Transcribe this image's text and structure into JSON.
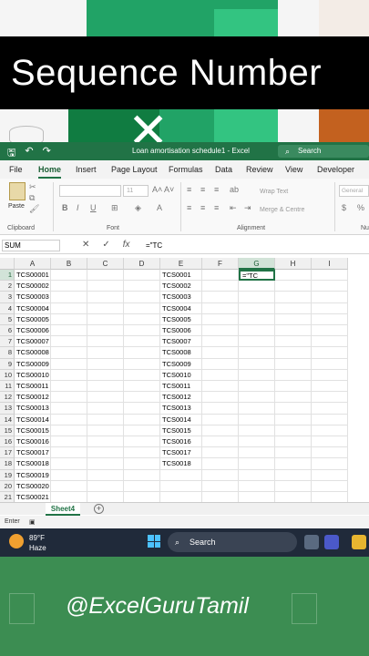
{
  "banner": {
    "title": "Sequence Number"
  },
  "excel": {
    "doc_title": "Loan amortisation schedule1 - Excel",
    "search_placeholder": "Search",
    "menu": [
      "File",
      "Home",
      "Insert",
      "Page Layout",
      "Formulas",
      "Data",
      "Review",
      "View",
      "Developer"
    ],
    "ribbon": {
      "paste": "Paste",
      "clipboard": "Clipboard",
      "font": "Font",
      "font_size": "11",
      "alignment": "Alignment",
      "wrap_text": "Wrap Text",
      "merge_centre": "Merge & Centre",
      "number_format": "General",
      "number_label": "Nu"
    },
    "name_box": "SUM",
    "formula_value": "=\"TC",
    "columns": [
      "A",
      "B",
      "C",
      "D",
      "E",
      "F",
      "G",
      "H",
      "I"
    ],
    "selected_column": "G",
    "rows": [
      {
        "n": "1",
        "A": "TCS00001",
        "E": "TCS0001",
        "G": "=\"TC"
      },
      {
        "n": "2",
        "A": "TCS00002",
        "E": "TCS0002"
      },
      {
        "n": "3",
        "A": "TCS00003",
        "E": "TCS0003"
      },
      {
        "n": "4",
        "A": "TCS00004",
        "E": "TCS0004"
      },
      {
        "n": "5",
        "A": "TCS00005",
        "E": "TCS0005"
      },
      {
        "n": "6",
        "A": "TCS00006",
        "E": "TCS0006"
      },
      {
        "n": "7",
        "A": "TCS00007",
        "E": "TCS0007"
      },
      {
        "n": "8",
        "A": "TCS00008",
        "E": "TCS0008"
      },
      {
        "n": "9",
        "A": "TCS00009",
        "E": "TCS0009"
      },
      {
        "n": "10",
        "A": "TCS00010",
        "E": "TCS0010"
      },
      {
        "n": "11",
        "A": "TCS00011",
        "E": "TCS0011"
      },
      {
        "n": "12",
        "A": "TCS00012",
        "E": "TCS0012"
      },
      {
        "n": "13",
        "A": "TCS00013",
        "E": "TCS0013"
      },
      {
        "n": "14",
        "A": "TCS00014",
        "E": "TCS0014"
      },
      {
        "n": "15",
        "A": "TCS00015",
        "E": "TCS0015"
      },
      {
        "n": "16",
        "A": "TCS00016",
        "E": "TCS0016"
      },
      {
        "n": "17",
        "A": "TCS00017",
        "E": "TCS0017"
      },
      {
        "n": "18",
        "A": "TCS00018",
        "E": "TCS0018"
      },
      {
        "n": "19",
        "A": "TCS00019"
      },
      {
        "n": "20",
        "A": "TCS00020"
      },
      {
        "n": "21",
        "A": "TCS00021"
      }
    ],
    "sheet_tab": "Sheet4",
    "add_sheet": "+",
    "status_mode": "Enter"
  },
  "taskbar": {
    "temperature": "89°F",
    "weather": "Haze",
    "search": "Search"
  },
  "footer": {
    "handle": "@ExcelGuruTamil"
  },
  "colors": {
    "excel_green": "#217346",
    "footer_green": "#3c8d52",
    "taskbar": "#202a3a"
  }
}
